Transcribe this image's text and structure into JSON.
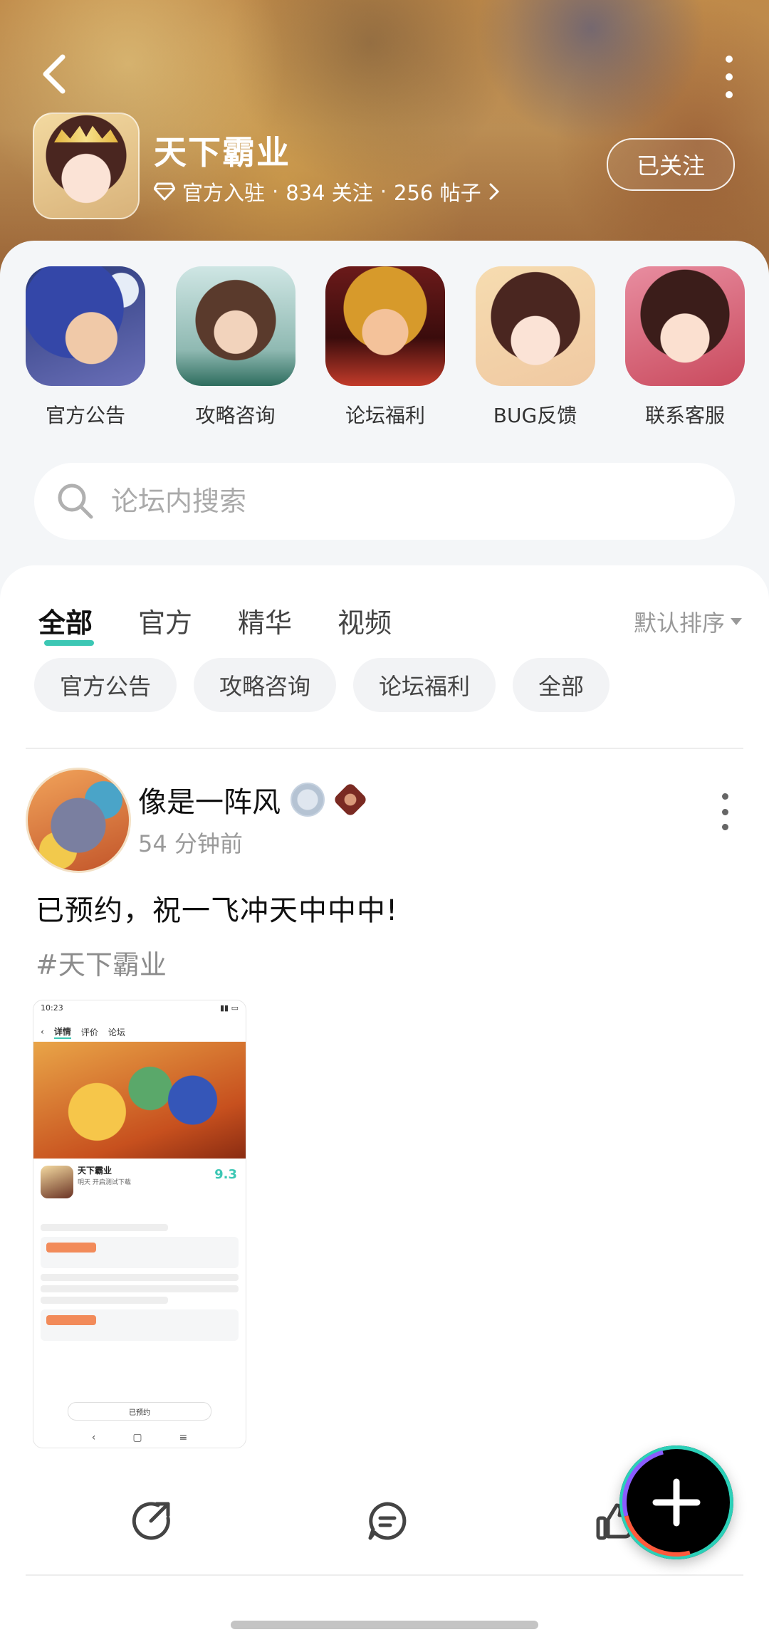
{
  "header": {
    "forum_name": "天下霸业",
    "official_label": "官方入驻",
    "followers": "834 关注",
    "posts": "256 帖子",
    "separator": "·",
    "follow_button": "已关注"
  },
  "shortcuts": [
    {
      "label": "官方公告"
    },
    {
      "label": "攻略咨询"
    },
    {
      "label": "论坛福利"
    },
    {
      "label": "BUG反馈"
    },
    {
      "label": "联系客服"
    }
  ],
  "search": {
    "placeholder": "论坛内搜索"
  },
  "tabs": [
    {
      "label": "全部",
      "active": true
    },
    {
      "label": "官方"
    },
    {
      "label": "精华"
    },
    {
      "label": "视频"
    }
  ],
  "sort": {
    "label": "默认排序"
  },
  "chips": [
    {
      "label": "官方公告"
    },
    {
      "label": "攻略咨询"
    },
    {
      "label": "论坛福利"
    },
    {
      "label": "全部"
    }
  ],
  "post": {
    "author": "像是一阵风",
    "time": "54 分钟前",
    "text": "已预约，祝一飞冲天中中中!",
    "tag": "#天下霸业",
    "image": {
      "status_time": "10:23",
      "tab_detail": "详情",
      "tab_review": "评价",
      "tab_forum": "论坛",
      "game_title": "天下霸业",
      "game_sub": "明天 开启测试下载",
      "score": "9.3",
      "reserved_button": "已预约"
    }
  },
  "colors": {
    "accent": "#3cc7b4",
    "card_bg": "#f4f6f8"
  }
}
